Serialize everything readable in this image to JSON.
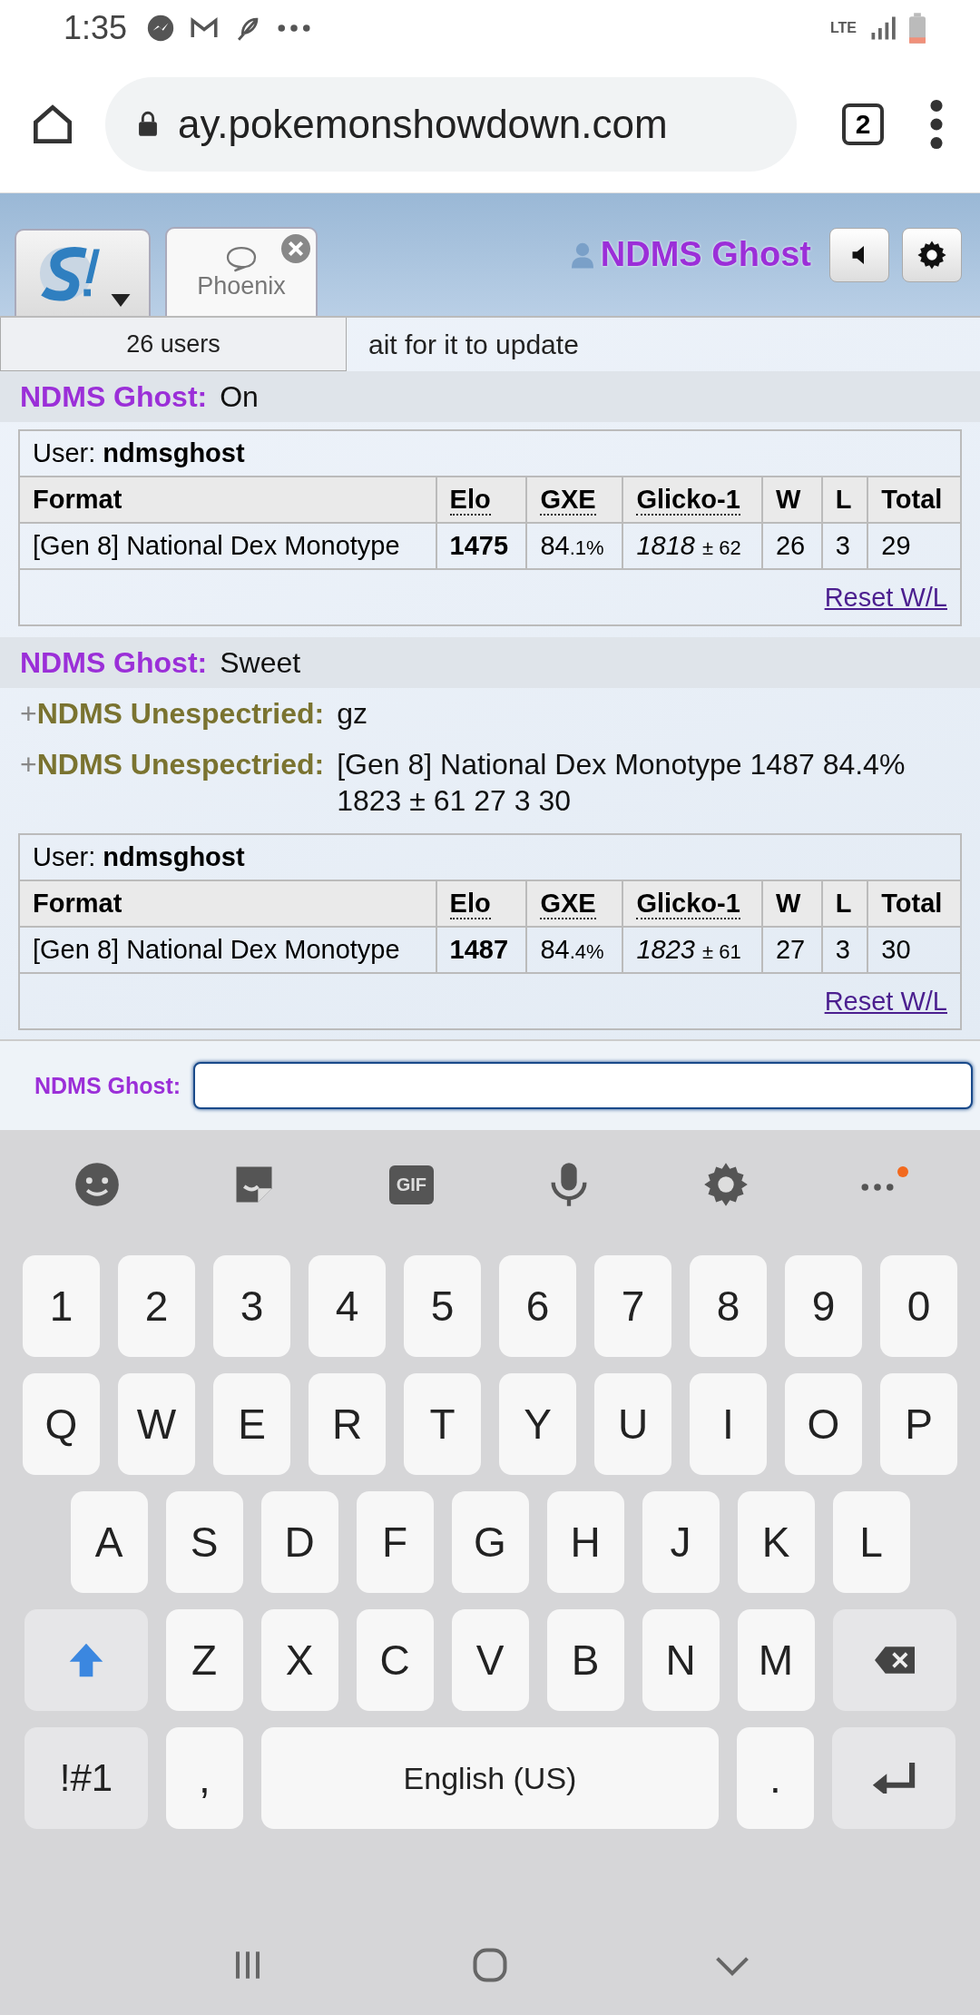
{
  "status_bar": {
    "time": "1:35",
    "network": "LTE"
  },
  "browser": {
    "url": "ay.pokemonshowdown.com",
    "tab_count": "2"
  },
  "header": {
    "tabs": [
      {
        "kind": "home",
        "selected": false
      },
      {
        "kind": "room",
        "label": "Phoenix",
        "selected": true
      }
    ],
    "user": "NDMS Ghost"
  },
  "users_popup": "26 users",
  "messages": [
    {
      "kind": "system",
      "text": "ait for it to update"
    },
    {
      "kind": "chat",
      "user": "NDMS Ghost:",
      "color": "#9b2fd8",
      "text": "On",
      "highlighted": true
    },
    {
      "kind": "ladder",
      "user_label": "User:",
      "username": "ndmsghost",
      "columns": [
        "Format",
        "Elo",
        "GXE",
        "Glicko-1",
        "W",
        "L",
        "Total"
      ],
      "row": {
        "format": "[Gen 8] National Dex Monotype",
        "elo": "1475",
        "gxe": "84",
        "gxe_decimal": ".1%",
        "glicko": "1818",
        "glicko_dev": "± 62",
        "w": "26",
        "l": "3",
        "total": "29"
      },
      "reset": "Reset W/L"
    },
    {
      "kind": "chat",
      "user": "NDMS Ghost:",
      "color": "#9b2fd8",
      "text": "Sweet",
      "highlighted": true
    },
    {
      "kind": "chat",
      "rank": "+",
      "user": "NDMS Unespectried:",
      "color": "#7a7330",
      "text": "gz",
      "highlighted": false
    },
    {
      "kind": "chat",
      "rank": "+",
      "user": "NDMS Unespectried:",
      "color": "#7a7330",
      "text": "[Gen 8] National Dex Monotype 1487 84.4% 1823 ± 61 27 3 30",
      "highlighted": false
    },
    {
      "kind": "ladder",
      "user_label": "User:",
      "username": "ndmsghost",
      "columns": [
        "Format",
        "Elo",
        "GXE",
        "Glicko-1",
        "W",
        "L",
        "Total"
      ],
      "row": {
        "format": "[Gen 8] National Dex Monotype",
        "elo": "1487",
        "gxe": "84",
        "gxe_decimal": ".4%",
        "glicko": "1823",
        "glicko_dev": "± 61",
        "w": "27",
        "l": "3",
        "total": "30"
      },
      "reset": "Reset W/L"
    }
  ],
  "chat_input": {
    "label": "NDMS Ghost:",
    "focused": true
  },
  "keyboard": {
    "toolbar": [
      {
        "kind": "emoji"
      },
      {
        "kind": "sticker"
      },
      {
        "kind": "gif",
        "label": "GIF"
      },
      {
        "kind": "mic"
      },
      {
        "kind": "settings"
      },
      {
        "kind": "more",
        "badge": true
      }
    ],
    "rows": [
      {
        "keys": [
          {
            "kind": "char",
            "label": "1"
          },
          {
            "kind": "char",
            "label": "2"
          },
          {
            "kind": "char",
            "label": "3"
          },
          {
            "kind": "char",
            "label": "4"
          },
          {
            "kind": "char",
            "label": "5"
          },
          {
            "kind": "char",
            "label": "6"
          },
          {
            "kind": "char",
            "label": "7"
          },
          {
            "kind": "char",
            "label": "8"
          },
          {
            "kind": "char",
            "label": "9"
          },
          {
            "kind": "char",
            "label": "0"
          }
        ]
      },
      {
        "keys": [
          {
            "kind": "char",
            "label": "Q"
          },
          {
            "kind": "char",
            "label": "W"
          },
          {
            "kind": "char",
            "label": "E"
          },
          {
            "kind": "char",
            "label": "R"
          },
          {
            "kind": "char",
            "label": "T"
          },
          {
            "kind": "char",
            "label": "Y"
          },
          {
            "kind": "char",
            "label": "U"
          },
          {
            "kind": "char",
            "label": "I"
          },
          {
            "kind": "char",
            "label": "O"
          },
          {
            "kind": "char",
            "label": "P"
          }
        ]
      },
      {
        "keys": [
          {
            "kind": "char",
            "label": "A"
          },
          {
            "kind": "char",
            "label": "S"
          },
          {
            "kind": "char",
            "label": "D"
          },
          {
            "kind": "char",
            "label": "F"
          },
          {
            "kind": "char",
            "label": "G"
          },
          {
            "kind": "char",
            "label": "H"
          },
          {
            "kind": "char",
            "label": "J"
          },
          {
            "kind": "char",
            "label": "K"
          },
          {
            "kind": "char",
            "label": "L"
          }
        ]
      },
      {
        "keys": [
          {
            "kind": "shift"
          },
          {
            "kind": "char",
            "label": "Z"
          },
          {
            "kind": "char",
            "label": "X"
          },
          {
            "kind": "char",
            "label": "C"
          },
          {
            "kind": "char",
            "label": "V"
          },
          {
            "kind": "char",
            "label": "B"
          },
          {
            "kind": "char",
            "label": "N"
          },
          {
            "kind": "char",
            "label": "M"
          },
          {
            "kind": "backspace"
          }
        ]
      },
      {
        "keys": [
          {
            "kind": "symbols",
            "label": "!#1"
          },
          {
            "kind": "char",
            "label": ","
          },
          {
            "kind": "space",
            "label": "English (US)"
          },
          {
            "kind": "char",
            "label": "."
          },
          {
            "kind": "enter"
          }
        ]
      }
    ]
  }
}
